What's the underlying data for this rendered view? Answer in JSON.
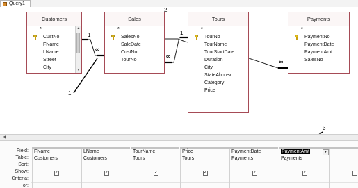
{
  "tab": {
    "label": "Query1"
  },
  "tables": {
    "customers": {
      "title": "Customers",
      "fields": [
        "*",
        "CustNo",
        "FName",
        "LName",
        "Street",
        "City"
      ]
    },
    "sales": {
      "title": "Sales",
      "fields": [
        "*",
        "SalesNo",
        "SaleDate",
        "CustNo",
        "TourNo"
      ]
    },
    "tours": {
      "title": "Tours",
      "fields": [
        "*",
        "TourNo",
        "TourName",
        "TourStartDate",
        "Duration",
        "City",
        "StateAbbrev",
        "Category",
        "Price"
      ]
    },
    "payments": {
      "title": "Payments",
      "fields": [
        "*",
        "PaymentNo",
        "PaymentDate",
        "PaymentAmt",
        "SalesNo"
      ]
    }
  },
  "relationships": [
    {
      "one_side": "Customers",
      "many_side": "Sales",
      "one_label": "1",
      "many_label": "∞"
    },
    {
      "one_side": "Tours",
      "many_side": "Sales",
      "one_label": "1",
      "many_label": "∞"
    },
    {
      "one_side": "Sales",
      "many_side": "Payments",
      "one_label": "",
      "many_label": "∞"
    }
  ],
  "callouts": [
    "1",
    "2",
    "3"
  ],
  "grid": {
    "row_labels": [
      "Field:",
      "Table:",
      "Sort:",
      "Show:",
      "Criteria:",
      "or:"
    ],
    "columns": [
      {
        "field": "FName",
        "table": "Customers",
        "show": true
      },
      {
        "field": "LName",
        "table": "Customers",
        "show": true
      },
      {
        "field": "TourName",
        "table": "Tours",
        "show": true
      },
      {
        "field": "Price",
        "table": "Tours",
        "show": true
      },
      {
        "field": "PaymentDate",
        "table": "Payments",
        "show": true
      },
      {
        "field": "PaymentAmt",
        "table": "Payments",
        "show": true,
        "selected": true
      },
      {
        "field": "",
        "table": "",
        "show": false
      }
    ]
  }
}
